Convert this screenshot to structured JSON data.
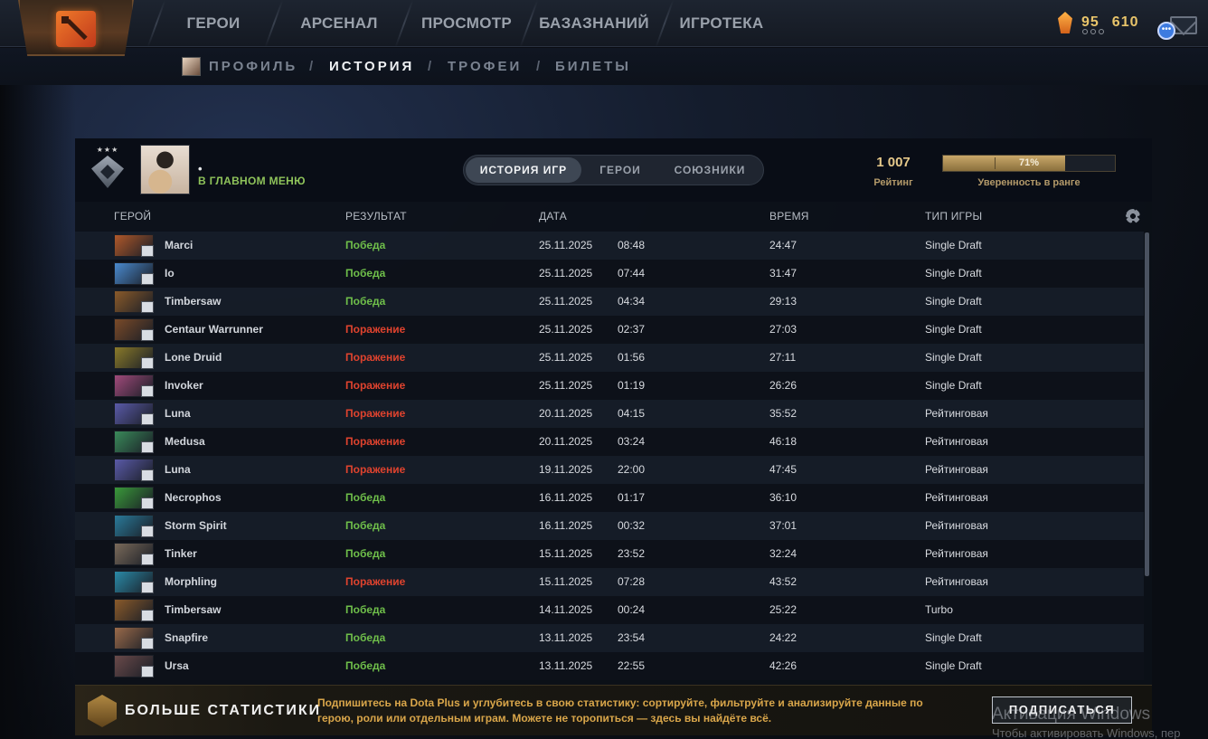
{
  "topnav": {
    "items": [
      "ГЕРОИ",
      "АРСЕНАЛ",
      "ПРОСМОТР",
      "БАЗАЗНАНИЙ",
      "ИГРОТЕКА"
    ],
    "currency_a": "95",
    "currency_b": "610",
    "logo_icon": "dota-logo-icon",
    "shard_icon": "shard-icon",
    "chat_icon": "chat-icon",
    "mail_icon": "mail-icon"
  },
  "subnav": {
    "items": [
      "ПРОФИЛЬ",
      "ИСТОРИЯ",
      "ТРОФЕИ",
      "БИЛЕТЫ"
    ],
    "separator": "/",
    "active": "ИСТОРИЯ"
  },
  "header": {
    "player_name": "•",
    "player_status": "В ГЛАВНОМ МЕНЮ",
    "tabs": [
      "ИСТОРИЯ ИГР",
      "ГЕРОИ",
      "СОЮЗНИКИ"
    ],
    "active_tab": "ИСТОРИЯ ИГР",
    "rating_value": "1 007",
    "rating_label": "Рейтинг",
    "confidence_value": "71%",
    "confidence_fraction": 0.71,
    "confidence_label": "Уверенность в ранге"
  },
  "table": {
    "columns": [
      "ГЕРОЙ",
      "РЕЗУЛЬТАТ",
      "ДАТА",
      "ВРЕМЯ",
      "ТИП ИГРЫ"
    ],
    "rows": [
      {
        "hero": "Marci",
        "result": "Победа",
        "win": true,
        "date": "25.11.2025",
        "time": "08:48",
        "duration": "24:47",
        "mode": "Single Draft",
        "color": "#b0582a"
      },
      {
        "hero": "Io",
        "result": "Победа",
        "win": true,
        "date": "25.11.2025",
        "time": "07:44",
        "duration": "31:47",
        "mode": "Single Draft",
        "color": "#4a8acf"
      },
      {
        "hero": "Timbersaw",
        "result": "Победа",
        "win": true,
        "date": "25.11.2025",
        "time": "04:34",
        "duration": "29:13",
        "mode": "Single Draft",
        "color": "#8a5a2a"
      },
      {
        "hero": "Centaur Warrunner",
        "result": "Поражение",
        "win": false,
        "date": "25.11.2025",
        "time": "02:37",
        "duration": "27:03",
        "mode": "Single Draft",
        "color": "#7a4a28"
      },
      {
        "hero": "Lone Druid",
        "result": "Поражение",
        "win": false,
        "date": "25.11.2025",
        "time": "01:56",
        "duration": "27:11",
        "mode": "Single Draft",
        "color": "#8a7a2a"
      },
      {
        "hero": "Invoker",
        "result": "Поражение",
        "win": false,
        "date": "25.11.2025",
        "time": "01:19",
        "duration": "26:26",
        "mode": "Single Draft",
        "color": "#a04a7a"
      },
      {
        "hero": "Luna",
        "result": "Поражение",
        "win": false,
        "date": "20.11.2025",
        "time": "04:15",
        "duration": "35:52",
        "mode": "Рейтинговая",
        "color": "#5a5aa8"
      },
      {
        "hero": "Medusa",
        "result": "Поражение",
        "win": false,
        "date": "20.11.2025",
        "time": "03:24",
        "duration": "46:18",
        "mode": "Рейтинговая",
        "color": "#3a8a5a"
      },
      {
        "hero": "Luna",
        "result": "Поражение",
        "win": false,
        "date": "19.11.2025",
        "time": "22:00",
        "duration": "47:45",
        "mode": "Рейтинговая",
        "color": "#5a5aa8"
      },
      {
        "hero": "Necrophos",
        "result": "Победа",
        "win": true,
        "date": "16.11.2025",
        "time": "01:17",
        "duration": "36:10",
        "mode": "Рейтинговая",
        "color": "#3a9a3a"
      },
      {
        "hero": "Storm Spirit",
        "result": "Победа",
        "win": true,
        "date": "16.11.2025",
        "time": "00:32",
        "duration": "37:01",
        "mode": "Рейтинговая",
        "color": "#2a7a9a"
      },
      {
        "hero": "Tinker",
        "result": "Победа",
        "win": true,
        "date": "15.11.2025",
        "time": "23:52",
        "duration": "32:24",
        "mode": "Рейтинговая",
        "color": "#7a6a5a"
      },
      {
        "hero": "Morphling",
        "result": "Поражение",
        "win": false,
        "date": "15.11.2025",
        "time": "07:28",
        "duration": "43:52",
        "mode": "Рейтинговая",
        "color": "#2a8aa8"
      },
      {
        "hero": "Timbersaw",
        "result": "Победа",
        "win": true,
        "date": "14.11.2025",
        "time": "00:24",
        "duration": "25:22",
        "mode": "Turbo",
        "color": "#8a5a2a"
      },
      {
        "hero": "Snapfire",
        "result": "Победа",
        "win": true,
        "date": "13.11.2025",
        "time": "23:54",
        "duration": "24:22",
        "mode": "Single Draft",
        "color": "#9a6a4a"
      },
      {
        "hero": "Ursa",
        "result": "Победа",
        "win": true,
        "date": "13.11.2025",
        "time": "22:55",
        "duration": "42:26",
        "mode": "Single Draft",
        "color": "#6a4a4a"
      }
    ]
  },
  "promo": {
    "title": "БОЛЬШЕ СТАТИСТИКИ",
    "text": "Подпишитесь на Dota Plus и углубитесь в свою статистику: сортируйте, фильтруйте и анализируйте данные по герою, роли или отдельным играм. Можете не торопиться — здесь вы найдёте всё.",
    "button": "ПОДПИСАТЬСЯ"
  },
  "watermark": {
    "line1": "Активация Windows",
    "line2": "Чтобы активировать Windows, пер"
  }
}
